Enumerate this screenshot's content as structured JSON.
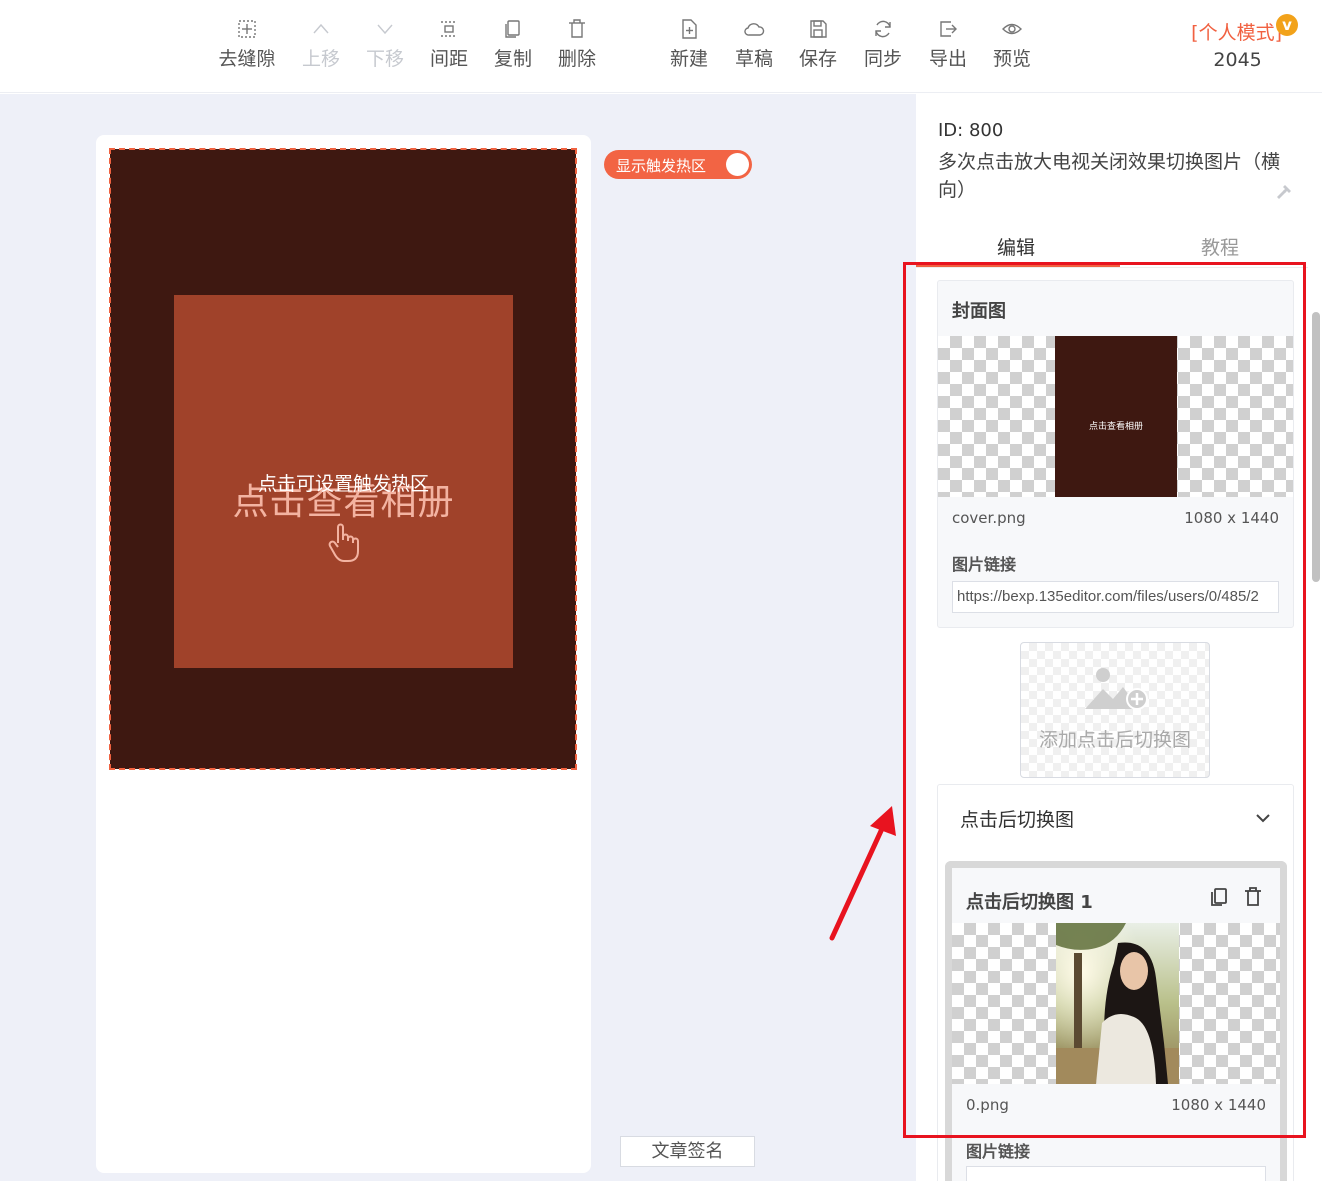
{
  "toolbar": {
    "items": [
      {
        "label": "去缝隙",
        "icon": "remove-gap-icon",
        "enabled": true
      },
      {
        "label": "上移",
        "icon": "arrow-up-icon",
        "enabled": false
      },
      {
        "label": "下移",
        "icon": "arrow-down-icon",
        "enabled": false
      },
      {
        "label": "间距",
        "icon": "spacing-icon",
        "enabled": true
      },
      {
        "label": "复制",
        "icon": "copy-icon",
        "enabled": true
      },
      {
        "label": "删除",
        "icon": "delete-icon",
        "enabled": true
      },
      {
        "label": "新建",
        "icon": "new-file-icon",
        "enabled": true
      },
      {
        "label": "草稿",
        "icon": "cloud-icon",
        "enabled": true
      },
      {
        "label": "保存",
        "icon": "save-icon",
        "enabled": true
      },
      {
        "label": "同步",
        "icon": "sync-icon",
        "enabled": true
      },
      {
        "label": "导出",
        "icon": "export-icon",
        "enabled": true
      },
      {
        "label": "预览",
        "icon": "eye-icon",
        "enabled": true
      }
    ],
    "mode": {
      "label": "[个人模式]",
      "badge": "v",
      "number": "2045"
    }
  },
  "canvas": {
    "toggle_label": "显示触发热区",
    "toggle_on": true,
    "inner_title": "点击查看相册",
    "hotspot_text": "点击可设置触发热区",
    "signature_label": "文章签名",
    "colors": {
      "artboard": "#3e1811",
      "card": "#a0422a",
      "accent": "#f26444"
    }
  },
  "panel": {
    "id_text": "ID: 800",
    "name": "多次点击放大电视关闭效果切换图片（横向）",
    "tabs": [
      {
        "label": "编辑",
        "active": true
      },
      {
        "label": "教程",
        "active": false
      }
    ],
    "cover": {
      "title": "封面图",
      "thumb_text": "点击查看相册",
      "file_name": "cover.png",
      "file_size": "1080 x 1440",
      "link_label": "图片链接",
      "link_value": "https://bexp.135editor.com/files/users/0/485/2"
    },
    "add_label": "添加点击后切换图",
    "switch_section": {
      "header": "点击后切换图",
      "items": [
        {
          "title": "点击后切换图 1",
          "file_name": "0.png",
          "file_size": "1080 x 1440",
          "link_label": "图片链接"
        }
      ]
    }
  },
  "annotation": {
    "highlight_color": "#e8131f"
  }
}
